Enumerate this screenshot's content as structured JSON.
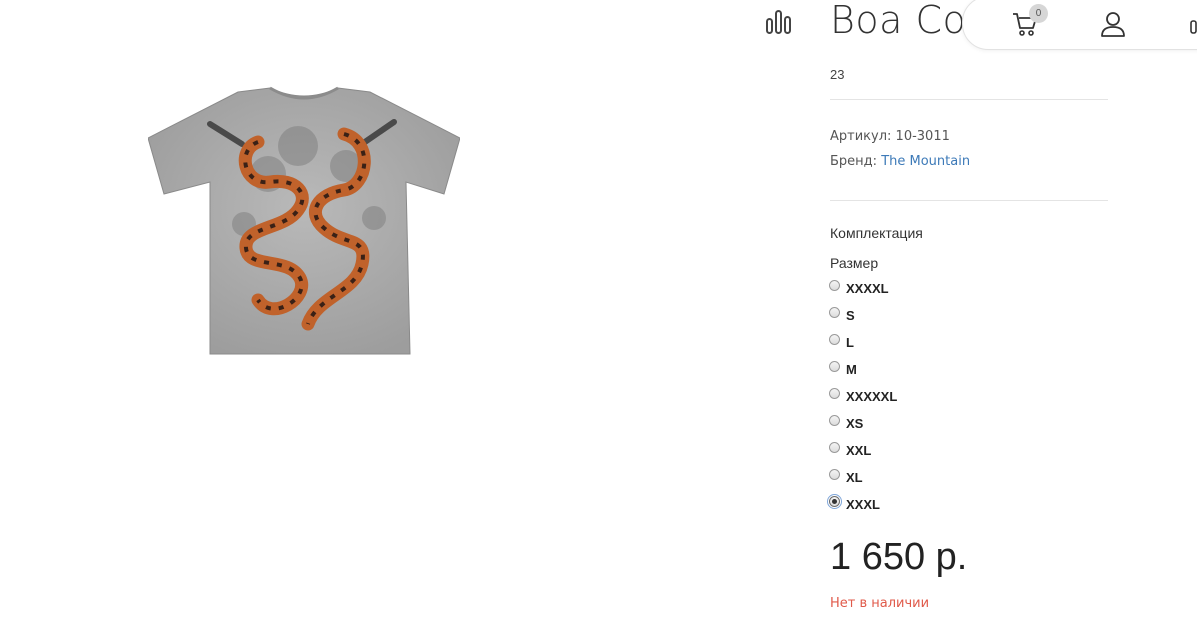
{
  "product": {
    "title": "Boa Con",
    "subtitle": "23",
    "article_label": "Артикул:",
    "article_value": "10-3011",
    "brand_label": "Бренд:",
    "brand_value": "The Mountain",
    "image_icon": "snake-tshirt-image"
  },
  "header": {
    "cart_count": "0",
    "icons": [
      "compare-icon",
      "cart-icon",
      "user-icon"
    ]
  },
  "options": {
    "section_label": "Комплектация",
    "size_label": "Размер",
    "sizes": [
      {
        "label": "XXXXL",
        "checked": false
      },
      {
        "label": "S",
        "checked": false
      },
      {
        "label": "L",
        "checked": false
      },
      {
        "label": "M",
        "checked": false
      },
      {
        "label": "XXXXXL",
        "checked": false
      },
      {
        "label": "XS",
        "checked": false
      },
      {
        "label": "XXL",
        "checked": false
      },
      {
        "label": "XL",
        "checked": false
      },
      {
        "label": "XXXL",
        "checked": true
      }
    ]
  },
  "pricing": {
    "price": "1 650 р.",
    "stock_status": "Нет в наличии"
  },
  "colors": {
    "link": "#3d7ab8",
    "out_of_stock": "#e05a4a",
    "shirt": "#a8a8a8",
    "snake": "#c0622b"
  }
}
